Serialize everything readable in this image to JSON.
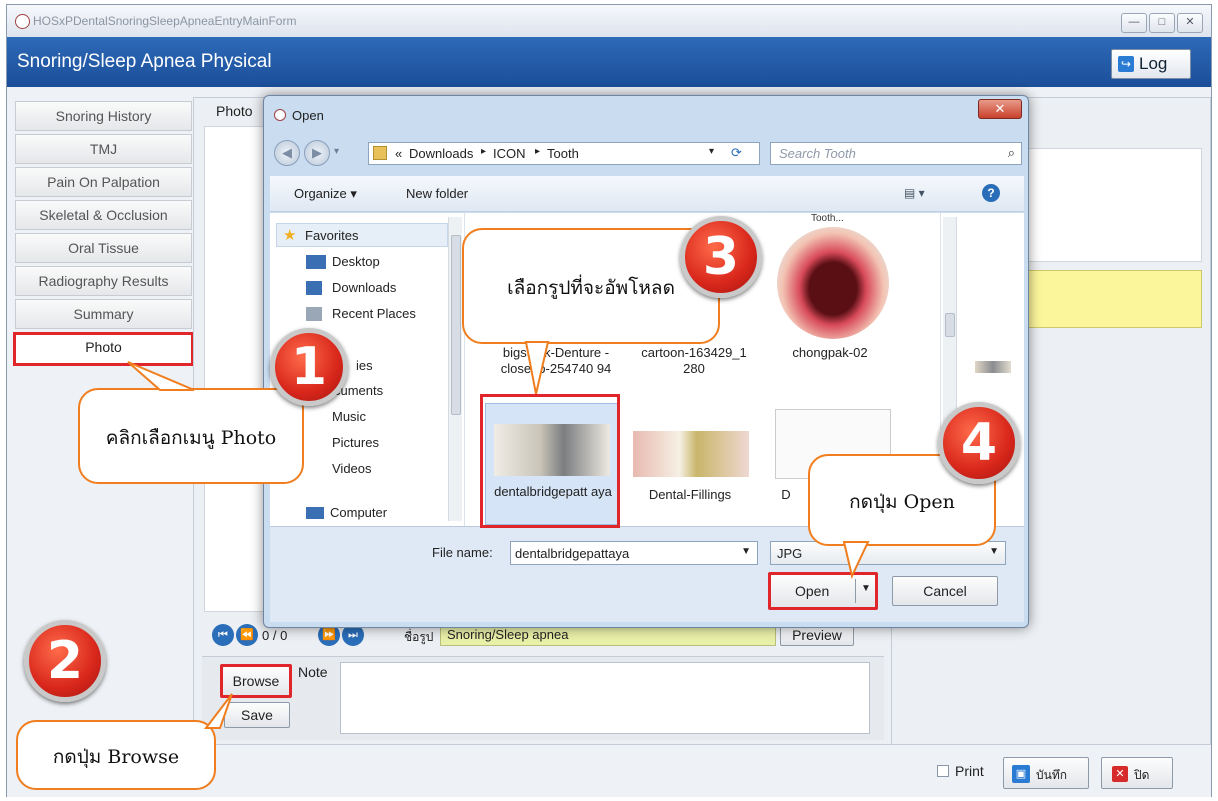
{
  "window": {
    "title": "HOSxPDentalSnoringSleepApneaEntryMainForm",
    "header_title": "Snoring/Sleep Apnea Physical",
    "log_button": "Log",
    "controls": {
      "minimize": "—",
      "maximize": "□",
      "close": "✕"
    }
  },
  "menu": {
    "items": [
      "Snoring History",
      "TMJ",
      "Pain On Palpation",
      "Skeletal & Occlusion",
      "Oral Tissue",
      "Radiography Results",
      "Summary",
      "Photo"
    ],
    "selected": "Photo"
  },
  "photo_panel": {
    "header": "Photo",
    "nav_counter": "0 / 0",
    "name_label": "ชื่อรูป",
    "name_value": "Snoring/Sleep apnea",
    "preview_button": "Preview",
    "browse_button": "Browse",
    "save_button": "Save",
    "note_label": "Note"
  },
  "footer": {
    "print_label": "Print",
    "save_button": "บันทึก",
    "close_button": "ปิด"
  },
  "dialog": {
    "title": "Open",
    "breadcrumb_prefix": "«",
    "breadcrumb": [
      "Downloads",
      "ICON",
      "Tooth"
    ],
    "search_placeholder": "Search Tooth",
    "organize": "Organize ▾",
    "new_folder": "New folder",
    "nav": {
      "favorites": "Favorites",
      "items": [
        "Desktop",
        "Downloads",
        "Recent Places",
        "ies",
        "cuments",
        "Music",
        "Pictures",
        "Videos",
        "Computer"
      ]
    },
    "files": [
      {
        "name": "bigstock-Denture -closeup-254740 94"
      },
      {
        "name": "cartoon-163429_1 280"
      },
      {
        "name": "chongpak-02"
      },
      {
        "name": "dentalbridgepatt aya"
      },
      {
        "name": "Dental-Fillings"
      },
      {
        "name": "D"
      }
    ],
    "preview_top_label": "Tooth...",
    "file_name_label": "File name:",
    "file_name_value": "dentalbridgepattaya",
    "file_type": "JPG",
    "open_button": "Open",
    "cancel_button": "Cancel"
  },
  "callouts": {
    "step1_text": "คลิกเลือกเมนู Photo",
    "step2_text": "กดปุ่ม Browse",
    "step3_text": "เลือกรูปที่จะอัพโหลด",
    "step4_text": "กดปุ่ม Open",
    "badges": [
      "1",
      "2",
      "3",
      "4"
    ]
  },
  "colors": {
    "header_blue": "#1f57a4",
    "highlight_red": "#e0262a",
    "callout_orange": "#f07d1e",
    "yellow_field": "#fbf69b"
  }
}
